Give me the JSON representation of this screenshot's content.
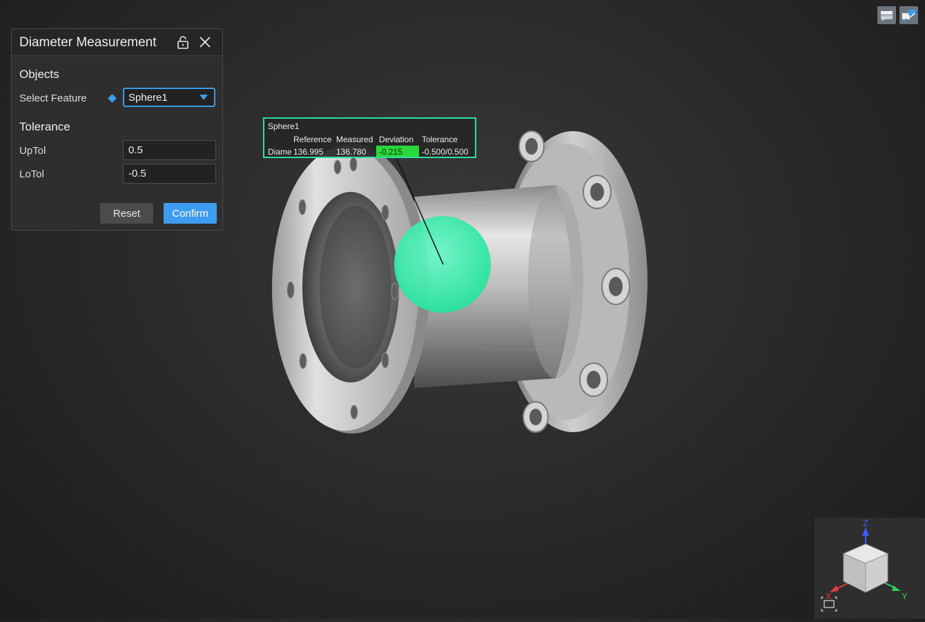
{
  "panel": {
    "title": "Diameter Measurement",
    "objects_title": "Objects",
    "select_feature_label": "Select Feature",
    "select_feature_value": "Sphere1",
    "tolerance_title": "Tolerance",
    "uptol_label": "UpTol",
    "uptol_value": "0.5",
    "lotol_label": "LoTol",
    "lotol_value": "-0.5",
    "reset_label": "Reset",
    "confirm_label": "Confirm"
  },
  "result": {
    "title": "Sphere1",
    "headers": [
      "Reference",
      "Measured",
      "Deviation",
      "Tolerance"
    ],
    "row_label": "Diameter",
    "reference": "136.995",
    "measured": "136.780",
    "deviation": "-0.215",
    "tolerance": "-0.500/0.500"
  },
  "axes": {
    "z": "Z",
    "x": "X",
    "y": "Y"
  },
  "colors": {
    "accent": "#3d9bf0",
    "highlight_sphere": "#2fe0a0",
    "deviation_ok": "#2bd83a",
    "axis_x": "#e23b3b",
    "axis_y": "#2fd05a",
    "axis_z": "#3f5bff"
  },
  "icons": {
    "lock": "unlock-icon",
    "close": "close-icon",
    "dropdown": "caret-down-icon",
    "top_right_1": "view-layout-icon",
    "top_right_2": "swap-view-icon",
    "fit": "fit-view-icon"
  }
}
